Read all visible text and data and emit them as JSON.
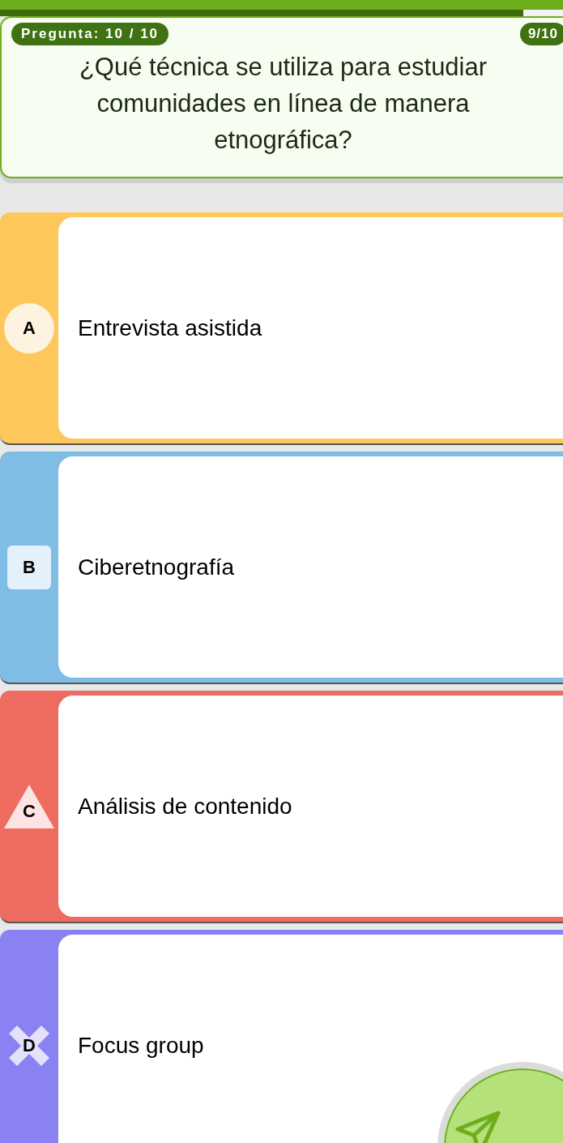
{
  "progress": {
    "level": 0.93
  },
  "question": {
    "counter": "Pregunta: 10 / 10",
    "score": "9/10",
    "text": "¿Qué técnica se utiliza para estudiar comunidades en línea de manera etnográfica?"
  },
  "options": [
    {
      "letter": "A",
      "text": "Entrevista asistida",
      "kind": "circle",
      "color": "#fec75b"
    },
    {
      "letter": "B",
      "text": "Ciberetnografía",
      "kind": "square",
      "color": "#80bde4"
    },
    {
      "letter": "C",
      "text": "Análisis de contenido",
      "kind": "triangle",
      "color": "#ee6b5f"
    },
    {
      "letter": "D",
      "text": "Focus group",
      "kind": "cross",
      "color": "#8a82f3"
    }
  ]
}
